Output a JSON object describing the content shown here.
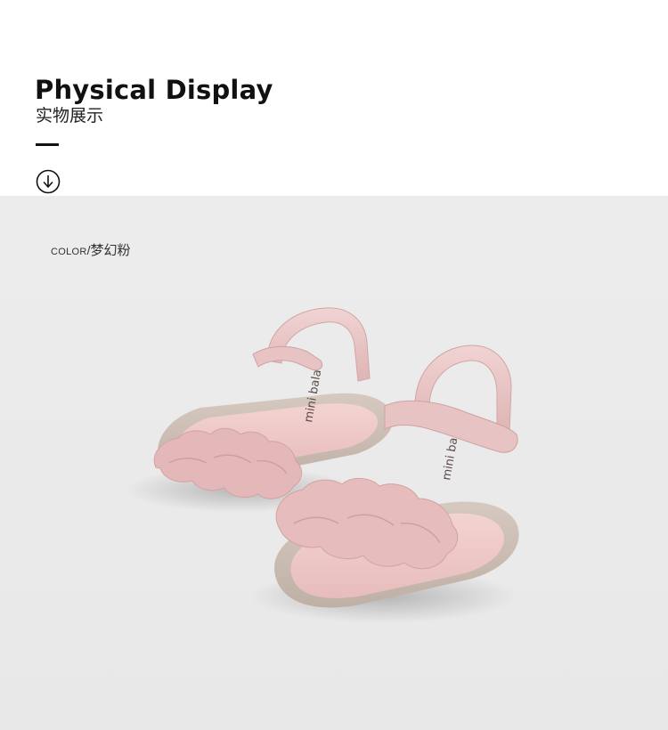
{
  "header": {
    "title_en": "Physical Display",
    "title_cn": "实物展示",
    "scroll_icon": "arrow-down-circle-icon"
  },
  "product": {
    "color_key": "COLOR",
    "color_separator": "/",
    "color_value": "梦幻粉",
    "brand_logo_text": "mini bala",
    "colors": {
      "leather_pink": "#e9c6c6",
      "ruffle_pink": "#e6bcbc",
      "insole": "#efcaca",
      "sole": "#cbbdb2",
      "background": "#ebebeb"
    }
  }
}
